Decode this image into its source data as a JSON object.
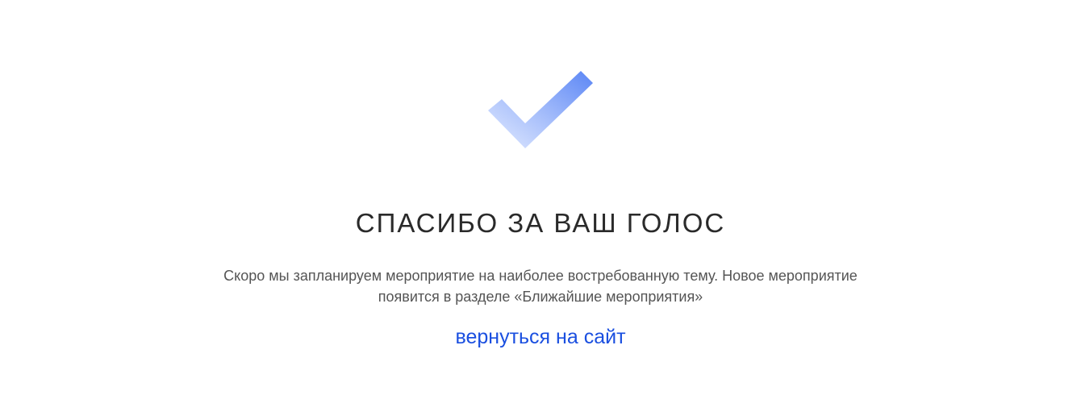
{
  "page": {
    "title": "СПАСИБО ЗА ВАШ ГОЛОС",
    "message": "Скоро мы запланируем мероприятие на наиболее востребованную тему. Новое мероприятие появится в разделе «Ближайшие мероприятия»",
    "back_link_label": "вернуться на сайт"
  },
  "icons": {
    "success": "checkmark-icon"
  },
  "colors": {
    "check_gradient_start": "#d4e0ff",
    "check_gradient_end": "#5b86f5",
    "title": "#2a2a2a",
    "message": "#555555",
    "link": "#1a4fe0",
    "background": "#ffffff"
  }
}
